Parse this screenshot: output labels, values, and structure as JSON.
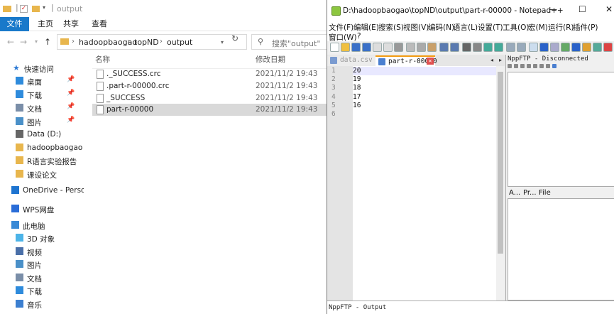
{
  "explorer": {
    "title": "output",
    "ribbon_tabs": [
      "文件",
      "主页",
      "共享",
      "查看"
    ],
    "breadcrumb": [
      "hadoopbaogao",
      "topND",
      "output"
    ],
    "search_placeholder": "搜索\"output\"",
    "columns": {
      "name": "名称",
      "modified": "修改日期"
    },
    "files": [
      {
        "name": "._SUCCESS.crc",
        "modified": "2021/11/2 19:43",
        "selected": false
      },
      {
        "name": ".part-r-00000.crc",
        "modified": "2021/11/2 19:43",
        "selected": false
      },
      {
        "name": "_SUCCESS",
        "modified": "2021/11/2 19:43",
        "selected": false
      },
      {
        "name": "part-r-00000",
        "modified": "2021/11/2 19:43",
        "selected": true
      }
    ],
    "nav": [
      {
        "label": "快速访问",
        "icon": "star-icon",
        "pinned": false
      },
      {
        "label": "桌面",
        "icon": "desktop-icon",
        "pinned": true
      },
      {
        "label": "下载",
        "icon": "download-icon",
        "pinned": true
      },
      {
        "label": "文档",
        "icon": "document-icon",
        "pinned": true
      },
      {
        "label": "图片",
        "icon": "picture-icon",
        "pinned": true
      },
      {
        "label": "Data (D:)",
        "icon": "drive-icon",
        "pinned": false
      },
      {
        "label": "hadoopbaogao",
        "icon": "folder-icon",
        "pinned": false
      },
      {
        "label": "R语言实验报告",
        "icon": "folder-icon",
        "pinned": false
      },
      {
        "label": "课设论文",
        "icon": "folder-icon",
        "pinned": false
      },
      {
        "label": "OneDrive - Perso",
        "icon": "cloud-icon",
        "pinned": false
      },
      {
        "label": "WPS网盘",
        "icon": "wps-cloud-icon",
        "pinned": false
      },
      {
        "label": "此电脑",
        "icon": "computer-icon",
        "pinned": false
      },
      {
        "label": "3D 对象",
        "icon": "3d-objects-icon",
        "pinned": false
      },
      {
        "label": "视频",
        "icon": "video-icon",
        "pinned": false
      },
      {
        "label": "图片",
        "icon": "picture-icon",
        "pinned": false
      },
      {
        "label": "文档",
        "icon": "document-icon",
        "pinned": false
      },
      {
        "label": "下载",
        "icon": "download-icon",
        "pinned": false
      },
      {
        "label": "音乐",
        "icon": "music-icon",
        "pinned": false
      }
    ]
  },
  "notepad": {
    "title": "D:\\hadoopbaogao\\topND\\output\\part-r-00000 - Notepad++",
    "menu_row1": [
      "文件(F)",
      "编辑(E)",
      "搜索(S)",
      "视图(V)",
      "编码(N)",
      "语言(L)",
      "设置(T)",
      "工具(O)",
      "宏(M)",
      "运行(R)",
      "插件(P)"
    ],
    "menu_row2": [
      "窗口(W)",
      "?"
    ],
    "tabs": [
      {
        "label": "data.csv",
        "active": false
      },
      {
        "label": "part-r-00000",
        "active": true
      }
    ],
    "lines": [
      "20",
      "19",
      "18",
      "17",
      "16",
      ""
    ],
    "ftp_title": "NppFTP - Disconnected",
    "ftp_columns": [
      "A...",
      "Pr...",
      "File"
    ],
    "output_title": "NppFTP - Output"
  }
}
